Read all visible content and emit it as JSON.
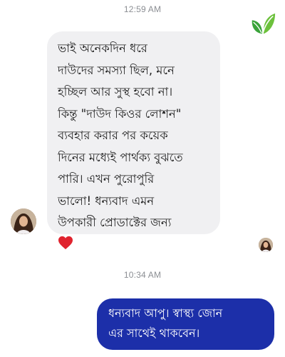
{
  "conversation": {
    "timestamps": [
      "12:59 AM",
      "10:34 AM"
    ],
    "incoming_message": {
      "text": "ভাই অনেকদিন ধরে\nদাউদের সমস্যা ছিল, মনে\nহচ্ছিল আর সুস্থ হবো না।\nকিন্তু \"দাউদ কিওর লোশন\"\nব্যবহার করার পর কয়েক\nদিনের মধ্যেই পার্থক্য বুঝতে\nপারি। এখন পুরোপুরি\nভালো! ধন্যবাদ এমন\nউপকারী প্রোডাক্টের জন্য",
      "emoji": "red-heart-icon"
    },
    "outgoing_message": {
      "text": "ধন্যবাদ আপু। স্বাস্থ্য জোন\nএর সাথেই থাকবেন।"
    }
  },
  "colors": {
    "incoming_bubble": "#f0f0f2",
    "outgoing_bubble": "#1c2fa9",
    "outgoing_text": "#ffffff",
    "heart": "#e0232e",
    "brand_green": "#3aa33a"
  },
  "icons": {
    "brand_logo": "leaf-logo-icon",
    "contact_avatar": "contact-avatar",
    "seen_indicator": "seen-avatar"
  }
}
